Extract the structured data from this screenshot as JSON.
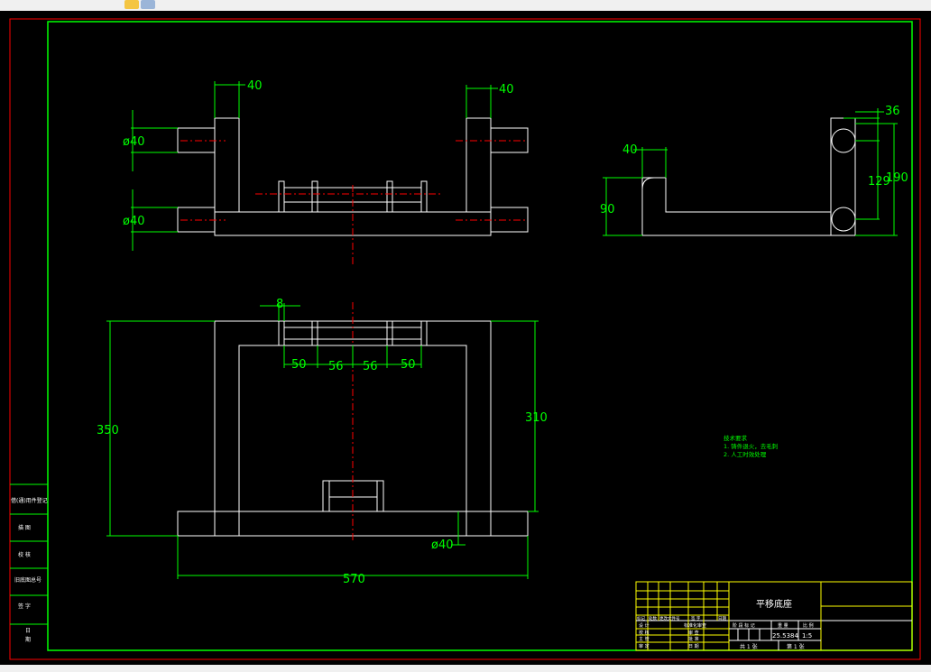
{
  "drawing": {
    "title": "平移底座",
    "scale": "1:5",
    "weight": "25.5384",
    "sheet_total": "共 1 张",
    "sheet_no": "第 1 张"
  },
  "dimensions": {
    "top_left_40": "40",
    "top_right_40": "40",
    "phi40_upper": "ø40",
    "phi40_lower": "ø40",
    "front_8": "8",
    "front_50_left": "50",
    "front_56_left": "56",
    "front_56_right": "56",
    "front_50_right": "50",
    "front_350": "350",
    "front_310": "310",
    "front_phi40": "ø40",
    "front_570": "570",
    "side_40": "40",
    "side_90": "90",
    "side_36": "36",
    "side_129": "129",
    "side_190": "190"
  },
  "notes": {
    "heading": "技术要求",
    "line1": "1. 铸件退火，去毛刺",
    "line2": "2. 人工时效处理"
  },
  "left_strip": {
    "c1": "借(通)用件登记",
    "c2": "描 图",
    "c3": "校 核",
    "c4": "旧底图总号",
    "c5": "签 字",
    "c6": "日",
    "c7": "期"
  },
  "title_block": {
    "r1": [
      "标记",
      "处数",
      "更改文件号",
      "签 字",
      "日期"
    ],
    "r2": [
      "设 计",
      "",
      "标准化审查"
    ],
    "r3": [
      "校 核",
      "",
      "审 查"
    ],
    "r4": [
      "主 管",
      "",
      "批 准"
    ],
    "r5": [
      "审 定",
      "",
      "日 期"
    ],
    "header": [
      "阶 段 标 记",
      "重 量",
      "比 例"
    ]
  },
  "colors": {
    "background": "#000000",
    "outline": "#ffffff",
    "dimension": "#00ff00",
    "centerline": "#ff0000",
    "frame": "#00ff00",
    "title_text": "#ffffff",
    "yellow": "#ffff00"
  }
}
